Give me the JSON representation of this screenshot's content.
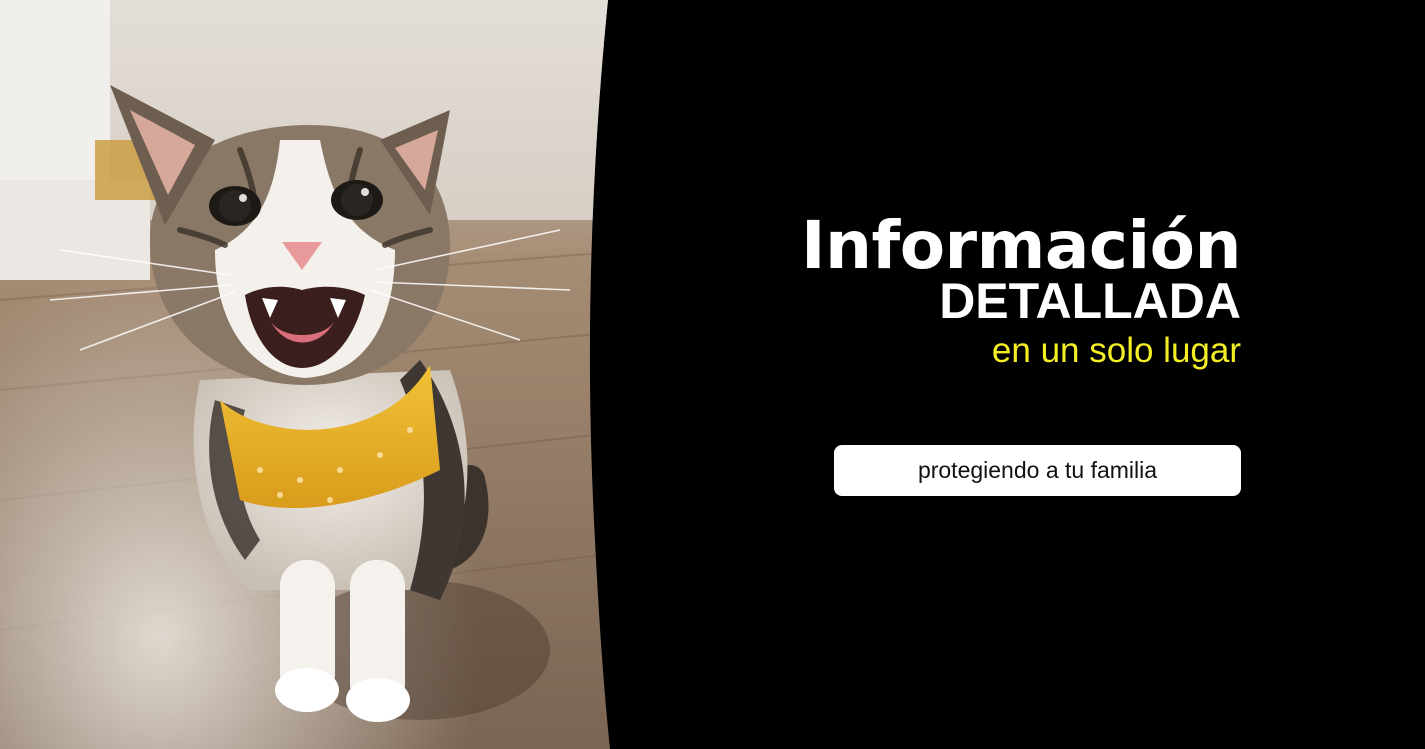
{
  "banner": {
    "headline": "Información",
    "subheadline": "DETALLADA",
    "tagline": "en un solo lugar",
    "cta_text": "protegiendo a tu familia"
  },
  "photo": {
    "subject": "cat-photo"
  },
  "colors": {
    "background": "#000000",
    "headline": "#ffffff",
    "tagline": "#f4ef25",
    "pill_background": "#ffffff",
    "pill_text": "#111111",
    "bandana": "#e8b22a"
  }
}
